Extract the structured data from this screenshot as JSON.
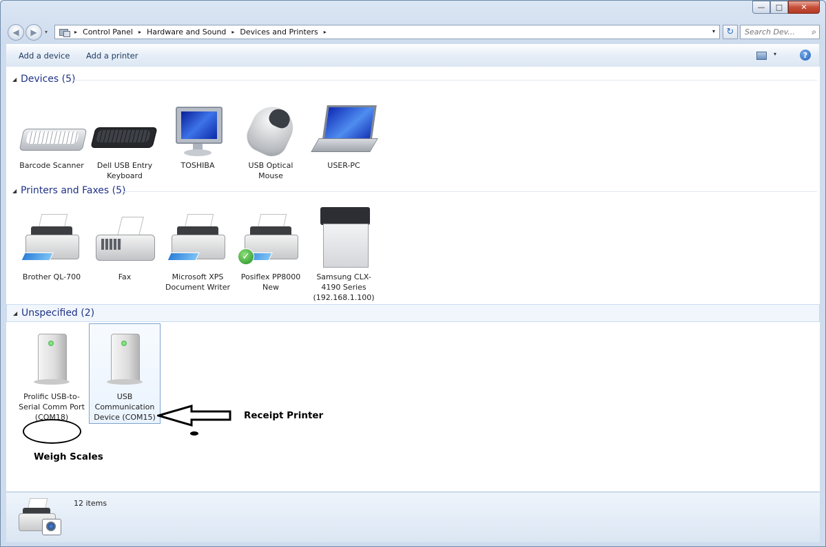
{
  "window": {
    "controls": {
      "minimize": "—",
      "maximize": "□",
      "close": "✕"
    }
  },
  "address": {
    "back_glyph": "◀",
    "forward_glyph": "▶",
    "breadcrumbs": [
      "Control Panel",
      "Hardware and Sound",
      "Devices and Printers"
    ],
    "separator": "▸",
    "dropdown_glyph": "▾",
    "refresh_glyph": "↻",
    "search_placeholder": "Search Dev...",
    "search_icon_glyph": "⌕"
  },
  "commands": {
    "add_device": "Add a device",
    "add_printer": "Add a printer",
    "view_dd_glyph": "▾",
    "help_glyph": "?"
  },
  "groups": [
    {
      "title": "Devices (5)",
      "items": [
        {
          "label": "Barcode Scanner",
          "icon": "keyboard-icon"
        },
        {
          "label": "Dell USB Entry Keyboard",
          "icon": "keyboard-icon"
        },
        {
          "label": "TOSHIBA",
          "icon": "monitor-icon"
        },
        {
          "label": "USB Optical Mouse",
          "icon": "mouse-icon"
        },
        {
          "label": "USER-PC",
          "icon": "laptop-icon"
        }
      ]
    },
    {
      "title": "Printers and Faxes (5)",
      "items": [
        {
          "label": "Brother QL-700",
          "icon": "printer-icon"
        },
        {
          "label": "Fax",
          "icon": "fax-icon"
        },
        {
          "label": "Microsoft XPS Document Writer",
          "icon": "printer-icon"
        },
        {
          "label": "Posiflex PP8000 New",
          "icon": "printer-icon",
          "default": true
        },
        {
          "label": "Samsung CLX-4190 Series (192.168.1.100)",
          "icon": "multifunction-printer-icon"
        }
      ]
    },
    {
      "title": "Unspecified (2)",
      "items": [
        {
          "label": "Prolific USB-to-Serial Comm Port (COM18)",
          "icon": "device-tower-icon"
        },
        {
          "label": "USB Communication Device (COM15)",
          "icon": "device-tower-icon",
          "selected": true
        }
      ]
    }
  ],
  "group_toggle_glyph": "◢",
  "default_check_glyph": "✓",
  "status": {
    "count": "12 items"
  },
  "annotations": {
    "receipt": "Receipt Printer",
    "weigh": "Weigh Scales"
  }
}
